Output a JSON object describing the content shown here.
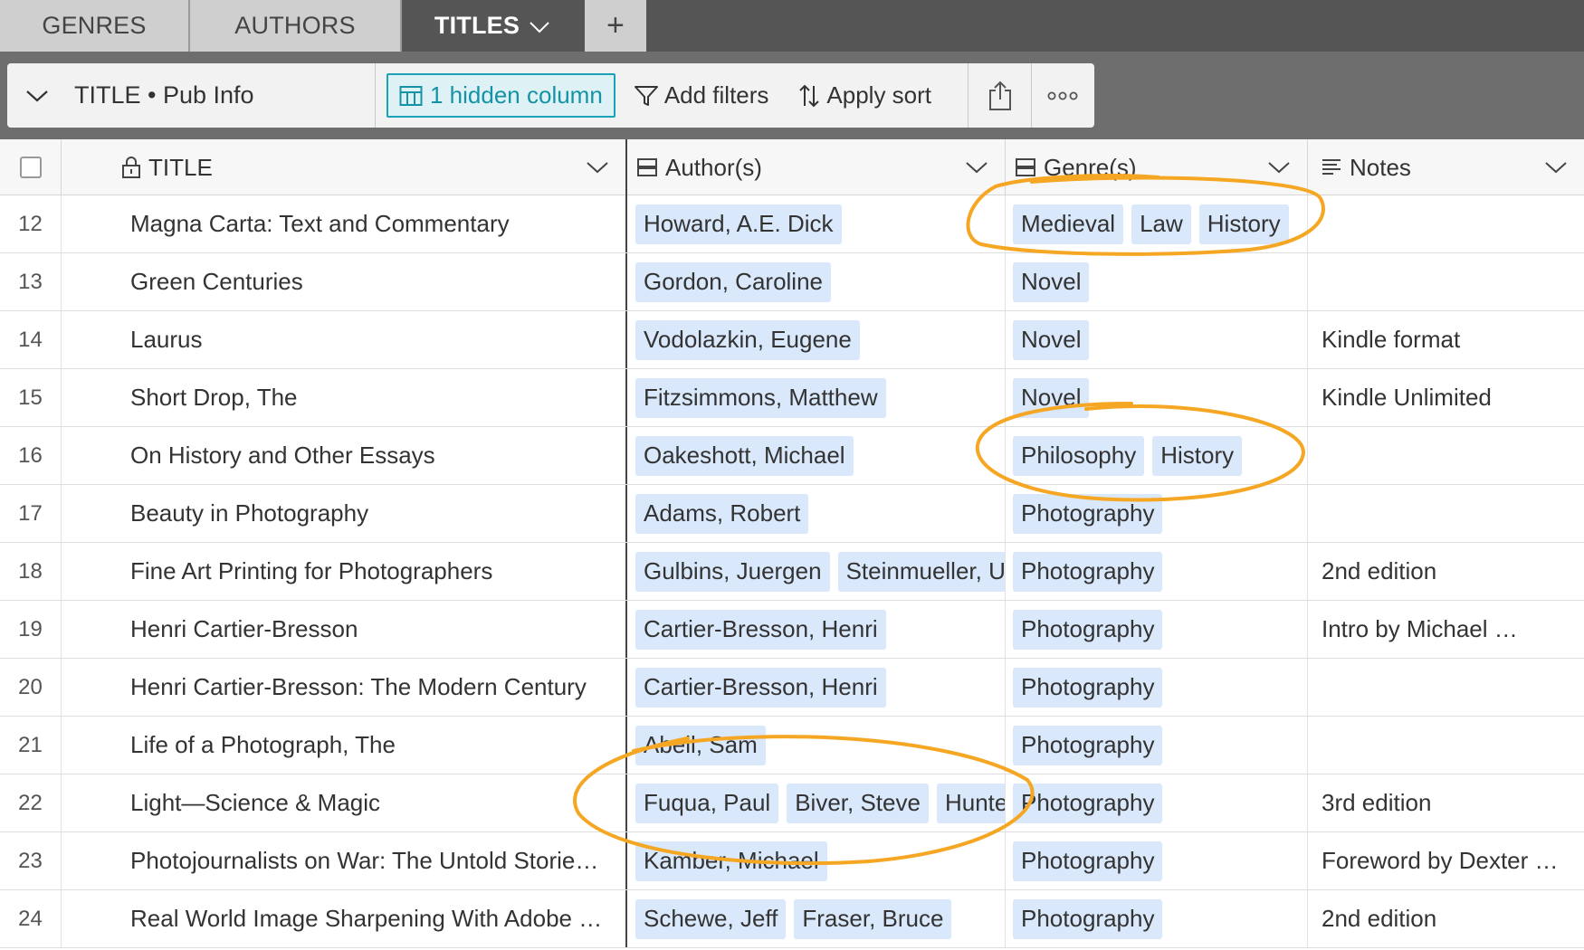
{
  "tabs": [
    {
      "label": "GENRES"
    },
    {
      "label": "AUTHORS"
    },
    {
      "label": "TITLES"
    },
    {
      "label": "+"
    }
  ],
  "toolbar": {
    "view_name": "TITLE • Pub Info",
    "hidden_columns": "1 hidden column",
    "add_filters": "Add filters",
    "apply_sort": "Apply sort"
  },
  "columns": {
    "title": "TITLE",
    "authors": "Author(s)",
    "genres": "Genre(s)",
    "notes": "Notes"
  },
  "rows": [
    {
      "num": "12",
      "title": "Magna Carta: Text and Commentary",
      "authors": [
        "Howard, A.E. Dick"
      ],
      "genres": [
        "Medieval",
        "Law",
        "History"
      ],
      "notes": ""
    },
    {
      "num": "13",
      "title": "Green Centuries",
      "authors": [
        "Gordon, Caroline"
      ],
      "genres": [
        "Novel"
      ],
      "notes": ""
    },
    {
      "num": "14",
      "title": "Laurus",
      "authors": [
        "Vodolazkin, Eugene"
      ],
      "genres": [
        "Novel"
      ],
      "notes": "Kindle format"
    },
    {
      "num": "15",
      "title": "Short Drop, The",
      "authors": [
        "Fitzsimmons, Matthew"
      ],
      "genres": [
        "Novel"
      ],
      "notes": "Kindle Unlimited"
    },
    {
      "num": "16",
      "title": "On History and Other Essays",
      "authors": [
        "Oakeshott, Michael"
      ],
      "genres": [
        "Philosophy",
        "History"
      ],
      "notes": ""
    },
    {
      "num": "17",
      "title": "Beauty in Photography",
      "authors": [
        "Adams, Robert"
      ],
      "genres": [
        "Photography"
      ],
      "notes": ""
    },
    {
      "num": "18",
      "title": "Fine Art Printing for Photographers",
      "authors": [
        "Gulbins, Juergen",
        "Steinmueller, U"
      ],
      "genres": [
        "Photography"
      ],
      "notes": "2nd edition"
    },
    {
      "num": "19",
      "title": "Henri Cartier-Bresson",
      "authors": [
        "Cartier-Bresson, Henri"
      ],
      "genres": [
        "Photography"
      ],
      "notes": "Intro by Michael …"
    },
    {
      "num": "20",
      "title": "Henri Cartier-Bresson: The Modern Century",
      "authors": [
        "Cartier-Bresson, Henri"
      ],
      "genres": [
        "Photography"
      ],
      "notes": ""
    },
    {
      "num": "21",
      "title": "Life of a Photograph, The",
      "authors": [
        "Abell, Sam"
      ],
      "genres": [
        "Photography"
      ],
      "notes": ""
    },
    {
      "num": "22",
      "title": "Light—Science & Magic",
      "authors": [
        "Fuqua, Paul",
        "Biver, Steve",
        "Hunte"
      ],
      "genres": [
        "Photography"
      ],
      "notes": "3rd edition"
    },
    {
      "num": "23",
      "title": "Photojournalists on War: The Untold Storie…",
      "authors": [
        "Kamber, Michael"
      ],
      "genres": [
        "Photography"
      ],
      "notes": "Foreword by Dexter …"
    },
    {
      "num": "24",
      "title": "Real World Image Sharpening With Adobe …",
      "authors": [
        "Schewe, Jeff",
        "Fraser, Bruce"
      ],
      "genres": [
        "Photography"
      ],
      "notes": "2nd edition"
    }
  ],
  "colors": {
    "accent": "#1aa3b8",
    "chip": "#d9e8fb",
    "annotation": "#f5a623"
  }
}
